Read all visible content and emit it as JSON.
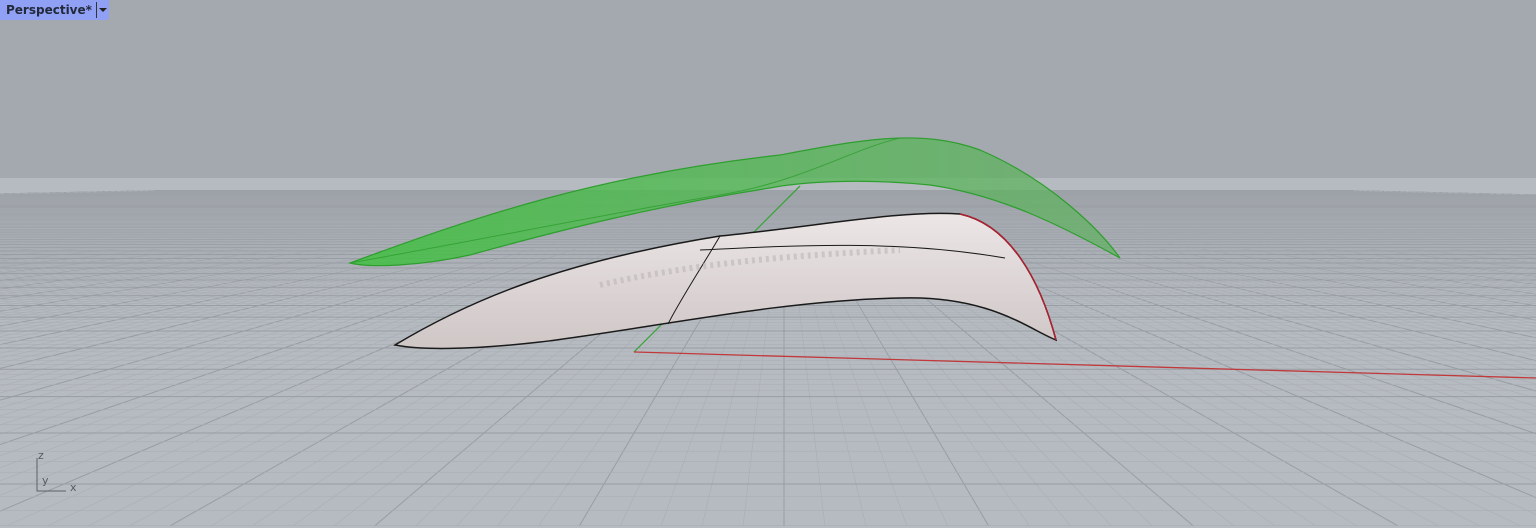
{
  "viewport": {
    "title": "Perspective*",
    "menu_icon": "triangle-down-icon",
    "axis_labels": {
      "z": "z",
      "y": "y",
      "x": "x"
    }
  },
  "colors": {
    "background": "#a4a9af",
    "grid_fine": "#b0b5bb",
    "grid_major": "#989da3",
    "x_axis": "#c0393b",
    "y_axis": "#3aa33a",
    "tab_bg": "#8fa0f5",
    "green_surface": "#3cb83c",
    "gray_surface": "#d9d1d1"
  }
}
